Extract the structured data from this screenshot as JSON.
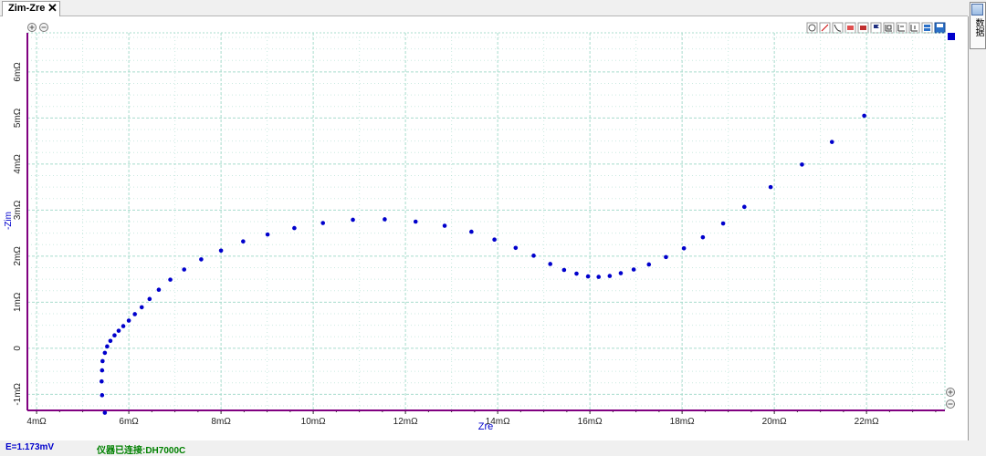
{
  "tab": {
    "title": "Zim-Zre",
    "close_icon": "close-icon"
  },
  "side_panel": {
    "label": "数据",
    "icon": "table-icon"
  },
  "toolbar": {
    "icons": [
      "target-icon",
      "pen-icon",
      "curve-icon",
      "marker-icon",
      "eraser-icon",
      "flag-icon",
      "fit-icon",
      "scale-x-icon",
      "scale-y-icon",
      "layers-icon",
      "save-icon"
    ]
  },
  "zoom_controls": {
    "zoom_in_icon": "zoom-in-icon",
    "zoom_out_icon": "zoom-out-icon"
  },
  "status": {
    "potential": "E=1.173mV",
    "connection": "仪器已连接:DH7000C"
  },
  "colors": {
    "series": "#0000cc",
    "grid": "#a8dccd",
    "axis_label": "#0000cc",
    "status_potential": "#0000cc",
    "status_connection": "#008000",
    "axis_line": "#800080"
  },
  "chart_data": {
    "type": "scatter",
    "title": "",
    "xlabel": "Zre",
    "ylabel": "-Zim",
    "xlim": [
      3.8,
      23.7
    ],
    "ylim": [
      -1.35,
      6.85
    ],
    "x_ticks": [
      4,
      6,
      8,
      10,
      12,
      14,
      16,
      18,
      20,
      22
    ],
    "x_tick_labels": [
      "4mΩ",
      "6mΩ",
      "8mΩ",
      "10mΩ",
      "12mΩ",
      "14mΩ",
      "16mΩ",
      "18mΩ",
      "20mΩ",
      "22mΩ"
    ],
    "y_ticks": [
      -1,
      0,
      1,
      2,
      3,
      4,
      5,
      6
    ],
    "y_tick_labels": [
      "-1mΩ",
      "0",
      "1mΩ",
      "2mΩ",
      "3mΩ",
      "4mΩ",
      "5mΩ",
      "6mΩ"
    ],
    "grid": true,
    "legend": "top-right",
    "series": [
      {
        "x": [
          5.48,
          5.42,
          5.41,
          5.42,
          5.43,
          5.48,
          5.53,
          5.6,
          5.69,
          5.78,
          5.88,
          6.0,
          6.13,
          6.28,
          6.45,
          6.65,
          6.9,
          7.2,
          7.57,
          8.0,
          8.48,
          9.01,
          9.59,
          10.21,
          10.86,
          11.55,
          12.22,
          12.85,
          13.43,
          13.93,
          14.39,
          14.78,
          15.14,
          15.44,
          15.71,
          15.96,
          16.19,
          16.43,
          16.67,
          16.95,
          17.28,
          17.65,
          18.04,
          18.45,
          18.89,
          19.35,
          19.92,
          20.6,
          21.25,
          21.95
        ],
        "y": [
          -1.4,
          -1.02,
          -0.72,
          -0.48,
          -0.28,
          -0.1,
          0.04,
          0.16,
          0.28,
          0.38,
          0.48,
          0.6,
          0.74,
          0.89,
          1.07,
          1.27,
          1.49,
          1.71,
          1.93,
          2.12,
          2.32,
          2.47,
          2.61,
          2.72,
          2.79,
          2.8,
          2.75,
          2.66,
          2.53,
          2.36,
          2.18,
          2.01,
          1.83,
          1.7,
          1.62,
          1.56,
          1.55,
          1.57,
          1.63,
          1.71,
          1.82,
          1.98,
          2.17,
          2.41,
          2.71,
          3.07,
          3.5,
          3.99,
          4.48,
          5.05
        ]
      }
    ]
  }
}
